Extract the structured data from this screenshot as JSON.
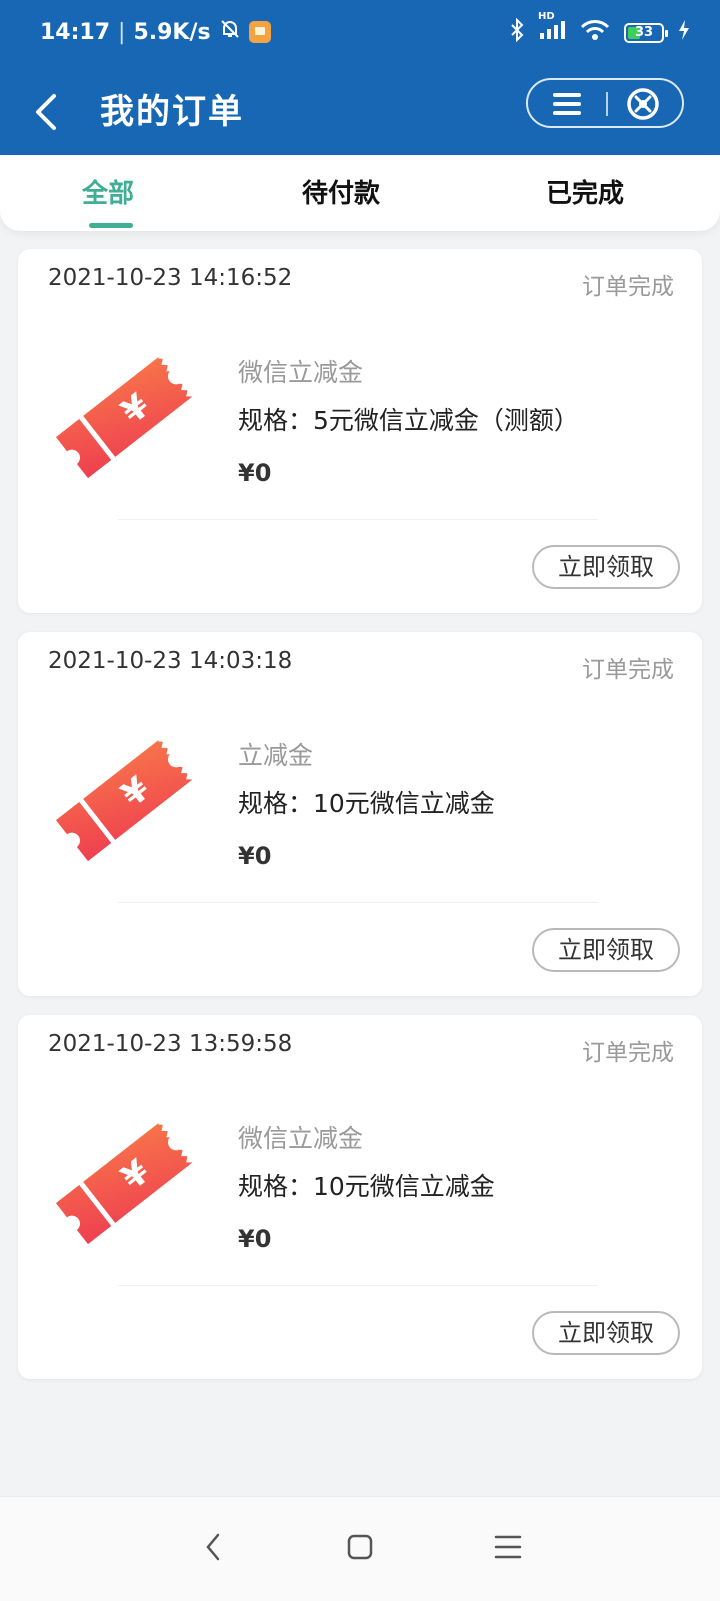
{
  "status_bar": {
    "time": "14:17",
    "speed": "5.9K/s",
    "battery": "33",
    "network": "HD"
  },
  "header": {
    "title": "我的订单"
  },
  "tabs": [
    {
      "label": "全部",
      "active": true
    },
    {
      "label": "待付款",
      "active": false
    },
    {
      "label": "已完成",
      "active": false
    }
  ],
  "orders": [
    {
      "time": "2021-10-23 14:16:52",
      "status": "订单完成",
      "name": "微信立减金",
      "spec": "规格：5元微信立减金（测额）",
      "price": "¥0",
      "action": "立即领取"
    },
    {
      "time": "2021-10-23 14:03:18",
      "status": "订单完成",
      "name": "立减金",
      "spec": "规格：10元微信立减金",
      "price": "¥0",
      "action": "立即领取"
    },
    {
      "time": "2021-10-23 13:59:58",
      "status": "订单完成",
      "name": "微信立减金",
      "spec": "规格：10元微信立减金",
      "price": "¥0",
      "action": "立即领取"
    }
  ],
  "colors": {
    "header_bg": "#1867b4",
    "tab_active": "#3fae95",
    "ticket_red": "#ef4b4b",
    "page_bg": "#f2f3f5"
  },
  "icons": {
    "back": "chevron-left-icon",
    "menu": "menu-icon",
    "close": "close-circle-icon",
    "ticket": "coupon-ticket-icon",
    "nav_back": "nav-back-icon",
    "nav_home": "nav-home-icon",
    "nav_menu": "nav-menu-icon"
  }
}
